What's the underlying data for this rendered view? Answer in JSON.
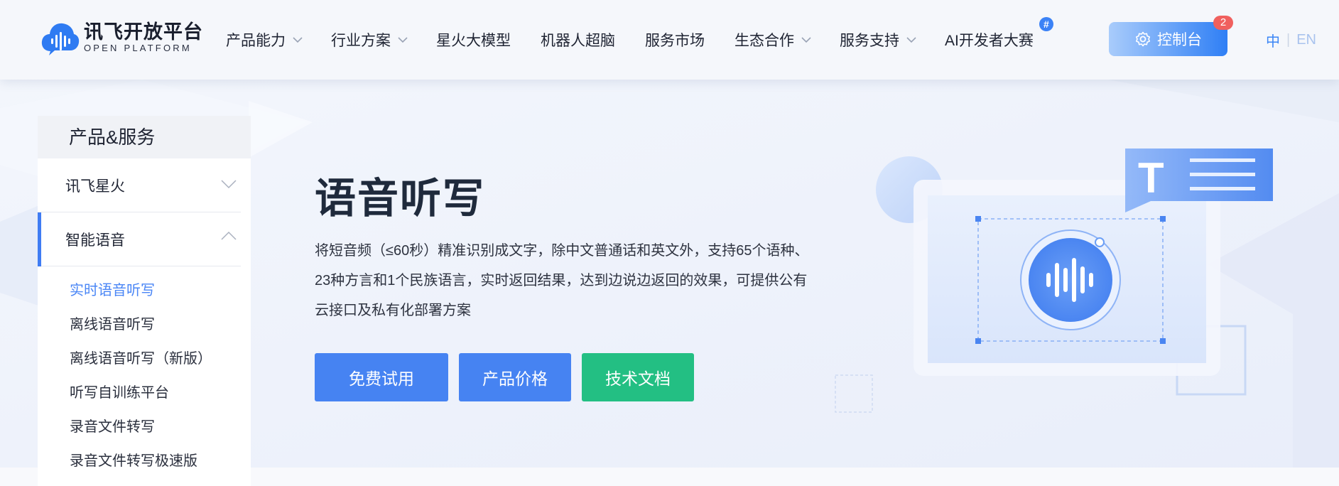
{
  "header": {
    "logo": {
      "cn": "讯飞开放平台",
      "en": "OPEN PLATFORM",
      "icon": "cloud-soundwave-icon"
    },
    "nav": [
      {
        "label": "产品能力",
        "dropdown": true
      },
      {
        "label": "行业方案",
        "dropdown": true
      },
      {
        "label": "星火大模型",
        "dropdown": false
      },
      {
        "label": "机器人超脑",
        "dropdown": false
      },
      {
        "label": "服务市场",
        "dropdown": false
      },
      {
        "label": "生态合作",
        "dropdown": true
      },
      {
        "label": "服务支持",
        "dropdown": true
      },
      {
        "label": "AI开发者大赛",
        "dropdown": false,
        "badge": "#"
      }
    ],
    "console": {
      "label": "控制台",
      "badge": "2",
      "icon": "gear-icon"
    },
    "lang": {
      "cn": "中",
      "separator": "|",
      "en": "EN"
    }
  },
  "sidebar": {
    "title": "产品&服务",
    "groups": [
      {
        "label": "讯飞星火",
        "expanded": false
      },
      {
        "label": "智能语音",
        "expanded": true
      }
    ],
    "sub_items": [
      {
        "label": "实时语音听写",
        "active": true
      },
      {
        "label": "离线语音听写",
        "active": false
      },
      {
        "label": "离线语音听写（新版）",
        "active": false
      },
      {
        "label": "听写自训练平台",
        "active": false
      },
      {
        "label": "录音文件转写",
        "active": false
      },
      {
        "label": "录音文件转写极速版",
        "active": false
      }
    ]
  },
  "hero": {
    "title": "语音听写",
    "description_lines": [
      "将短音频（≤60秒）精准识别成文字，除中文普通话和英文外，支持65个语种、",
      "23种方言和1个民族语言，实时返回结果，达到边说边返回的效果，可提供公有",
      "云接口及私有化部署方案"
    ],
    "buttons": {
      "trial": "免费试用",
      "price": "产品价格",
      "docs": "技术文档"
    },
    "illustration": {
      "bubble_letter": "T",
      "icons": [
        "text-bubble-icon",
        "soundwave-icon"
      ]
    }
  },
  "colors": {
    "primary": "#4683f2",
    "docs_green": "#23bf83",
    "active_blue": "#3f7cf3",
    "badge_red": "#f0605e"
  }
}
